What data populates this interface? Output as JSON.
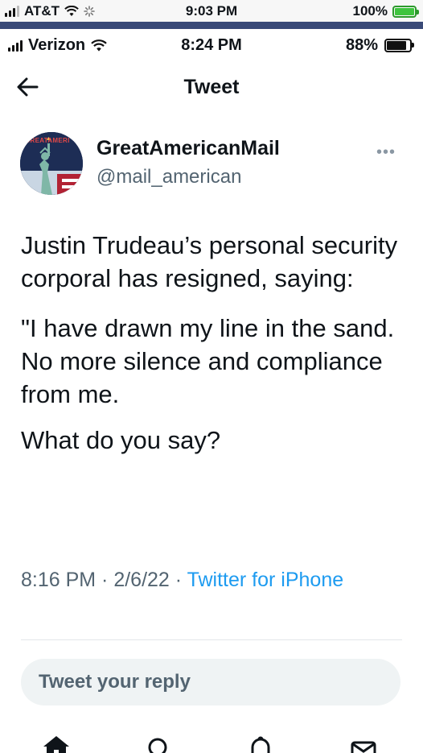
{
  "outer_status": {
    "carrier": "AT&T",
    "time": "9:03 PM",
    "battery": "100%"
  },
  "inner_status": {
    "carrier": "Verizon",
    "time": "8:24 PM",
    "battery": "88%"
  },
  "header": {
    "title": "Tweet"
  },
  "tweet": {
    "author_name": "GreatAmericanMail",
    "author_handle": "@mail_american",
    "avatar_text": "GREATAMERI",
    "paragraph1": "Justin Trudeau’s personal security corporal has resigned, saying:",
    "paragraph2": "\"I have drawn my line in the sand. No more silence and compliance from me.",
    "paragraph3": "What do you say?",
    "time": "8:16 PM",
    "separator": " · ",
    "date": "2/6/22",
    "source": "Twitter for iPhone"
  },
  "reply": {
    "placeholder": "Tweet your reply"
  },
  "tabs": [
    "home-icon",
    "search-icon",
    "notifications-icon",
    "messages-icon"
  ],
  "colors": {
    "accent": "#1d9bf0",
    "muted": "#536471",
    "outer_bar": "#3a4a78",
    "battery_green": "#3ec43e"
  }
}
